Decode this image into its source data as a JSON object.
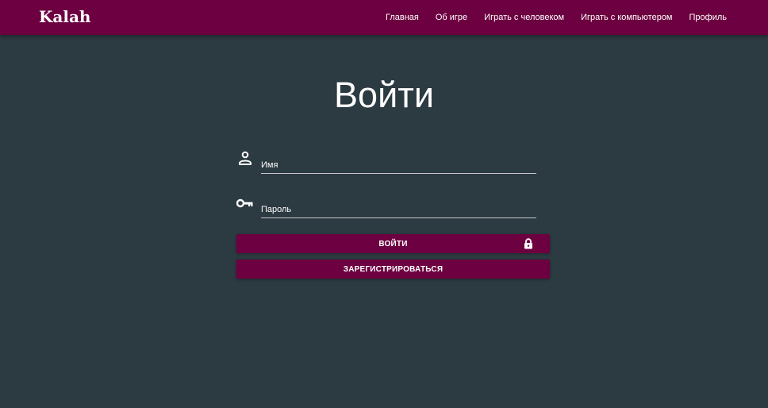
{
  "header": {
    "brand": "Kalah",
    "nav": [
      {
        "label": "Главная"
      },
      {
        "label": "Об игре"
      },
      {
        "label": "Играть с человеком"
      },
      {
        "label": "Играть с компьютером"
      },
      {
        "label": "Профиль"
      }
    ],
    "background_color": "#6d0040"
  },
  "login": {
    "title": "Войти",
    "username": {
      "placeholder": "Имя",
      "value": "",
      "icon": "person-icon"
    },
    "password": {
      "placeholder": "Пароль",
      "value": "",
      "icon": "key-icon"
    },
    "login_button": {
      "label": "ВОЙТИ",
      "icon": "lock-icon"
    },
    "register_button": {
      "label": "ЗАРЕГИСТРИРОВАТЬСЯ"
    }
  },
  "colors": {
    "page_background": "#2c3a41",
    "accent": "#6d0040"
  }
}
